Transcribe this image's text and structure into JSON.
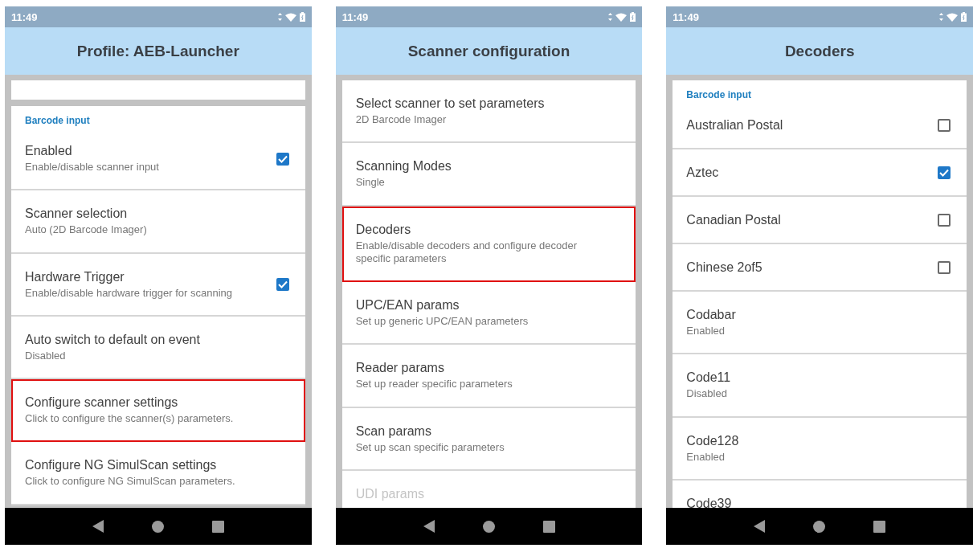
{
  "phones": [
    {
      "status": {
        "time": "11:49"
      },
      "title": "Profile: AEB-Launcher",
      "cards": [
        {
          "kind": "scrolled"
        },
        {
          "kind": "full",
          "section": "Barcode input",
          "rows": [
            {
              "kind": "checkbox",
              "title": "Enabled",
              "subtitle": "Enable/disable scanner input",
              "checked": true,
              "highlighted": false
            },
            {
              "kind": "plain",
              "title": "Scanner selection",
              "subtitle": "Auto (2D Barcode Imager)",
              "highlighted": false
            },
            {
              "kind": "checkbox",
              "title": "Hardware Trigger",
              "subtitle": "Enable/disable hardware trigger for scanning",
              "checked": true,
              "highlighted": false
            },
            {
              "kind": "plain",
              "title": "Auto switch to default on event",
              "subtitle": "Disabled",
              "highlighted": false
            },
            {
              "kind": "plain",
              "title": "Configure scanner settings",
              "subtitle": "Click to configure the scanner(s) parameters.",
              "highlighted": true
            },
            {
              "kind": "plain",
              "title": "Configure NG SimulScan settings",
              "subtitle": "Click to configure NG SimulScan parameters.",
              "highlighted": false
            }
          ]
        }
      ]
    },
    {
      "status": {
        "time": "11:49"
      },
      "title": "Scanner configuration",
      "cards": [
        {
          "kind": "full",
          "rows": [
            {
              "kind": "plain",
              "title": "Select scanner to set parameters",
              "subtitle": "2D Barcode Imager",
              "highlighted": false,
              "disabled": false
            },
            {
              "kind": "plain",
              "title": "Scanning Modes",
              "subtitle": "Single",
              "highlighted": false,
              "disabled": false
            },
            {
              "kind": "plain",
              "title": "Decoders",
              "subtitle": "Enable/disable decoders and configure decoder specific parameters",
              "highlighted": true,
              "disabled": false
            },
            {
              "kind": "plain",
              "title": "UPC/EAN params",
              "subtitle": "Set up generic UPC/EAN parameters",
              "highlighted": false,
              "disabled": false
            },
            {
              "kind": "plain",
              "title": "Reader params",
              "subtitle": "Set up reader specific parameters",
              "highlighted": false,
              "disabled": false
            },
            {
              "kind": "plain",
              "title": "Scan params",
              "subtitle": "Set up scan specific parameters",
              "highlighted": false,
              "disabled": false
            },
            {
              "kind": "plain",
              "title": "UDI params",
              "highlighted": false,
              "disabled": true
            }
          ]
        }
      ]
    },
    {
      "status": {
        "time": "11:49"
      },
      "title": "Decoders",
      "cards": [
        {
          "kind": "full",
          "section": "Barcode input",
          "rows": [
            {
              "kind": "checkbox",
              "title": "Australian Postal",
              "checked": false,
              "highlighted": false
            },
            {
              "kind": "checkbox",
              "title": "Aztec",
              "checked": true,
              "highlighted": false
            },
            {
              "kind": "checkbox",
              "title": "Canadian Postal",
              "checked": false,
              "highlighted": false
            },
            {
              "kind": "checkbox",
              "title": "Chinese 2of5",
              "checked": false,
              "highlighted": false
            },
            {
              "kind": "plain",
              "title": "Codabar",
              "subtitle": "Enabled",
              "highlighted": false
            },
            {
              "kind": "plain",
              "title": "Code11",
              "subtitle": "Disabled",
              "highlighted": false
            },
            {
              "kind": "plain",
              "title": "Code128",
              "subtitle": "Enabled",
              "highlighted": false
            },
            {
              "kind": "plain",
              "title": "Code39",
              "highlighted": false
            }
          ]
        }
      ]
    }
  ]
}
